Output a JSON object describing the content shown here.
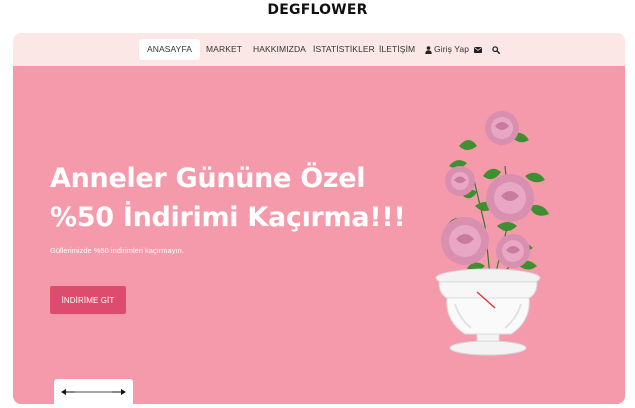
{
  "brand": {
    "name": "DEGFLOWER"
  },
  "nav": {
    "items": [
      {
        "label": "ANASAYFA",
        "active": true
      },
      {
        "label": "MARKET"
      },
      {
        "label": "HAKKIMIZDA"
      },
      {
        "label": "İSTATİSTİKLER"
      },
      {
        "label": "İLETİŞİM"
      }
    ],
    "login_label": "Giriş Yap",
    "icons": [
      "user-icon",
      "mail-icon",
      "search-icon"
    ]
  },
  "hero": {
    "headline_line1": "Anneler Gününe Özel",
    "headline_line2": "%50 İndirimi Kaçırma!!!",
    "subtext": "Güllerimizde %50 indirimleri kaçırmayın.",
    "cta_label": "İNDİRİME GİT",
    "background_color": "#f59aaa",
    "cta_color": "#dd4c6c"
  },
  "slider": {
    "icons": [
      "arrow-left-icon",
      "arrow-right-icon"
    ]
  }
}
